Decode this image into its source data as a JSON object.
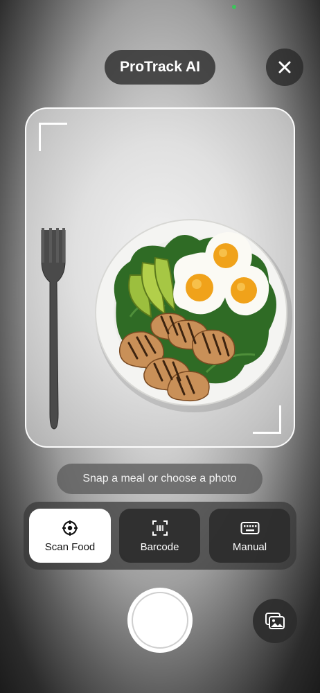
{
  "app": {
    "title": "ProTrack AI"
  },
  "header": {
    "close_icon": "close-icon"
  },
  "camera": {
    "hint": "Snap a meal or choose a photo",
    "preview_subject": "plate with eggs, grilled chicken, avocado and spinach, fork beside"
  },
  "modes": [
    {
      "label": "Scan Food",
      "icon": "scan-target-icon",
      "active": true
    },
    {
      "label": "Barcode",
      "icon": "barcode-icon",
      "active": false
    },
    {
      "label": "Manual",
      "icon": "keyboard-icon",
      "active": false
    }
  ],
  "controls": {
    "shutter_icon": "shutter-icon",
    "gallery_icon": "photo-gallery-icon"
  },
  "colors": {
    "status_dot": "#3cc45a",
    "active_mode_bg": "#ffffff",
    "pill_bg": "#2c2c2c"
  }
}
